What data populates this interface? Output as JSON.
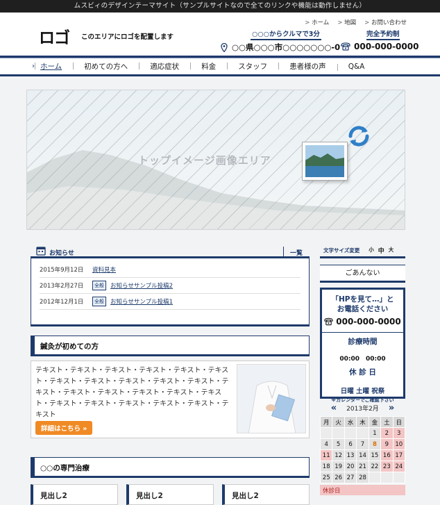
{
  "topbar": {
    "text": "ムスビィのデザインテーマサイト（サンプルサイトなので全てのリンクや機能は動作しません）"
  },
  "header": {
    "logo": "ロゴ",
    "logo_note": "このエリアにロゴを配置します",
    "links": [
      "ホーム",
      "地図",
      "お問い合わせ"
    ],
    "access": "○○○からクルマで3分",
    "reserve": "完全予約制",
    "address": "○○県○○○市○○○○○○○-0",
    "phone": "000-000-0000"
  },
  "nav": {
    "items": [
      "ホーム",
      "初めての方へ",
      "適応症状",
      "料金",
      "スタッフ",
      "患者様の声",
      "Q&A"
    ],
    "active": 0
  },
  "hero": {
    "caption": "トップイメージ画像エリア"
  },
  "news": {
    "title": "お知らせ",
    "more": "一覧",
    "items": [
      {
        "date": "2015年9月12日",
        "tag": "",
        "text": "資料見本"
      },
      {
        "date": "2013年2月27日",
        "tag": "全般",
        "text": "お知らせサンプル投稿2"
      },
      {
        "date": "2012年12月1日",
        "tag": "全般",
        "text": "お知らせサンプル投稿1"
      }
    ]
  },
  "intro": {
    "title": "鍼灸が初めての方",
    "text": "テキスト・テキスト・テキスト・テキスト・テキスト・テキスト・テキスト・テキスト・テキスト・テキスト・テキスト・テキスト・テキスト・テキスト・テキスト・テキスト・テキスト・テキスト・テキスト・テキスト・テキスト・テキスト・テキスト",
    "button": "詳細はこちら »"
  },
  "treatment": {
    "title": "○○の専門治療",
    "subheads": [
      "見出し2",
      "見出し2",
      "見出し2"
    ]
  },
  "sidebar": {
    "font_size_label": "文字サイズ変更",
    "font_sizes": [
      "小",
      "中",
      "大"
    ],
    "guide": "ごあんない",
    "contact": {
      "line1": "「HPを見て…」と",
      "line2": "お電話ください",
      "phone": "000-000-0000",
      "hours_label": "診療時間",
      "hours": "00:00　00:00",
      "closed_label": "休 診 日",
      "closed_days": "日曜 土曜 祝祭",
      "note": "※カレンダーでご確認下さい"
    },
    "calendar": {
      "month": "2013年2月",
      "weekdays": [
        "月",
        "火",
        "水",
        "木",
        "金",
        "土",
        "日"
      ],
      "rows": [
        [
          "",
          "",
          "",
          "",
          "1",
          "2",
          "3"
        ],
        [
          "4",
          "5",
          "6",
          "7",
          "8",
          "9",
          "10"
        ],
        [
          "11",
          "12",
          "13",
          "14",
          "15",
          "16",
          "17"
        ],
        [
          "18",
          "19",
          "20",
          "21",
          "22",
          "23",
          "24"
        ],
        [
          "25",
          "26",
          "27",
          "28",
          "",
          "",
          ""
        ]
      ],
      "off_days": [
        "2",
        "3",
        "9",
        "10",
        "11",
        "16",
        "17",
        "23",
        "24"
      ],
      "highlight_day": "8",
      "legend": "休診日"
    }
  }
}
